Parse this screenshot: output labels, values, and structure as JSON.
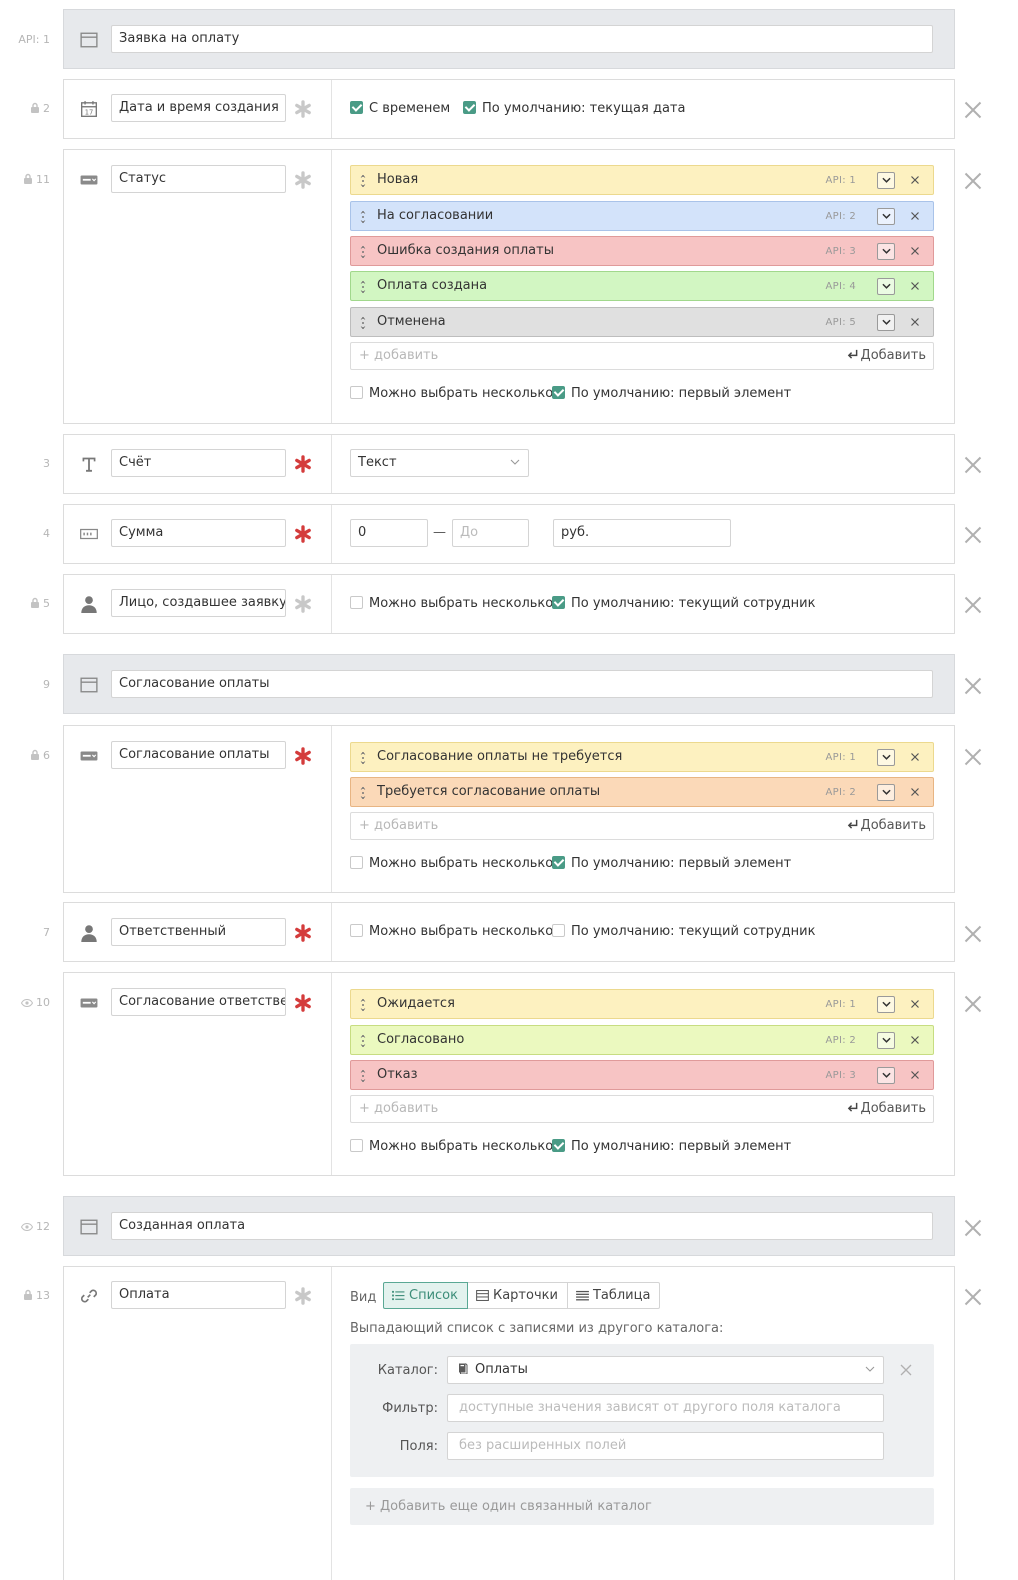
{
  "icons": {
    "lock": "lock-icon",
    "eye": "eye-icon",
    "section": "section-icon",
    "date": "calendar-icon",
    "select": "list-icon",
    "text": "text-t-icon",
    "number": "number-icon",
    "user": "user-icon",
    "link": "link-icon"
  },
  "colors": {
    "yellow": "#fdf1c0",
    "blue": "#d3e3fa",
    "red": "#f7c4c4",
    "green": "#d2f6c2",
    "gray": "#e0e0e0",
    "peach": "#fbd9b8",
    "lime": "#ebf9bf",
    "check": "#4a9b86",
    "required": "#d43c3c"
  },
  "common": {
    "add_placeholder": "+ добавить",
    "add_button": "Добавить",
    "multi_select": "Можно выбрать несколько",
    "default_first": "По умолчанию: первый элемент",
    "default_current_user": "По умолчанию: текущий сотрудник"
  },
  "fields": {
    "f1": {
      "api": "API: 1",
      "name": "Заявка на оплату"
    },
    "f2": {
      "api": "2",
      "name": "Дата и время создания",
      "opt_time": "С временем",
      "opt_default": "По умолчанию: текущая дата"
    },
    "f11": {
      "api": "11",
      "name": "Статус",
      "options": [
        {
          "label": "Новая",
          "api": "API: 1"
        },
        {
          "label": "На согласовании",
          "api": "API: 2"
        },
        {
          "label": "Ошибка создания оплаты",
          "api": "API: 3"
        },
        {
          "label": "Оплата создана",
          "api": "API: 4"
        },
        {
          "label": "Отменена",
          "api": "API: 5"
        }
      ]
    },
    "f3": {
      "api": "3",
      "name": "Счёт",
      "type_value": "Текст"
    },
    "f4": {
      "api": "4",
      "name": "Сумма",
      "from": "0",
      "to_placeholder": "До",
      "unit": "руб."
    },
    "f5": {
      "api": "5",
      "name": "Лицо, создавшее заявку"
    },
    "f9": {
      "api": "9",
      "name": "Согласование оплаты"
    },
    "f6": {
      "api": "6",
      "name": "Согласование оплаты",
      "options": [
        {
          "label": "Согласование оплаты не требуется",
          "api": "API: 1"
        },
        {
          "label": "Требуется согласование оплаты",
          "api": "API: 2"
        }
      ]
    },
    "f7": {
      "api": "7",
      "name": "Ответственный"
    },
    "f10": {
      "api": "10",
      "name": "Согласование ответственным",
      "options": [
        {
          "label": "Ожидается",
          "api": "API: 1"
        },
        {
          "label": "Согласовано",
          "api": "API: 2"
        },
        {
          "label": "Отказ",
          "api": "API: 3"
        }
      ]
    },
    "f12": {
      "api": "12",
      "name": "Созданная оплата"
    },
    "f13": {
      "api": "13",
      "name": "Оплата",
      "view_label": "Вид",
      "views": [
        "Список",
        "Карточки",
        "Таблица"
      ],
      "description": "Выпадающий список с записями из другого каталога:",
      "catalog_label": "Каталог:",
      "catalog_value": "Оплаты",
      "filter_label": "Фильтр:",
      "filter_placeholder": "доступные значения зависят от другого поля каталога",
      "fields_label": "Поля:",
      "fields_placeholder": "без расширенных полей",
      "add_catalog": "+ Добавить еще один связанный каталог"
    }
  }
}
